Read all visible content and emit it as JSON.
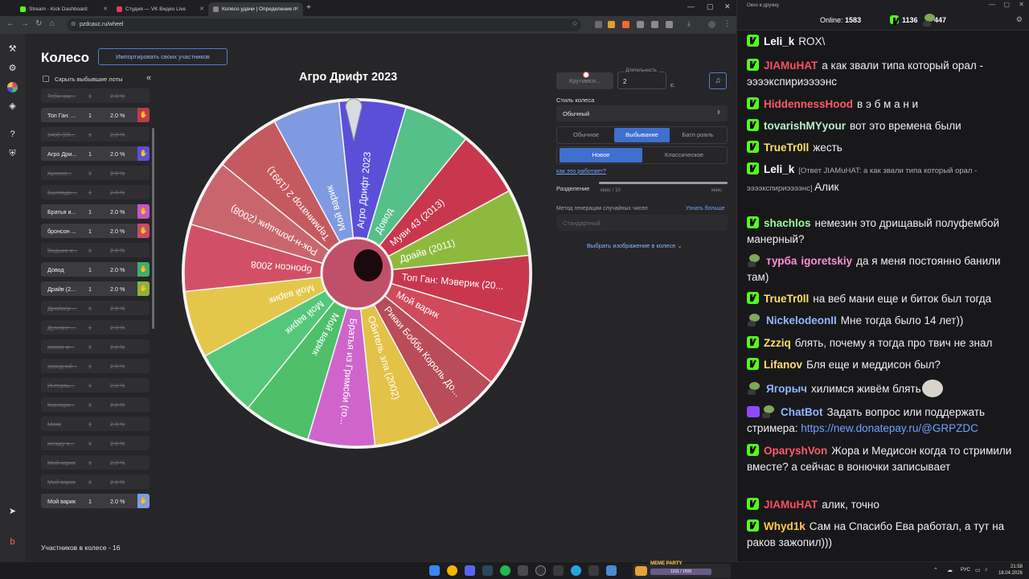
{
  "browser": {
    "tabs": [
      {
        "label": "Stream - Kick Dashboard",
        "color": "#53fc18"
      },
      {
        "label": "Студия — VK Видео Live",
        "color": "#e63b5a"
      },
      {
        "label": "Колесо удачи | Определение п",
        "color": "#888888"
      }
    ],
    "url": "pzdcauc.ru/wheel"
  },
  "page": {
    "title": "Колесо",
    "import_label": "Импортировать своих участников",
    "hide_label": "Скрыть выбывшие лоты",
    "collapse_glyph": "«",
    "participants_count": "Участников в колесе - 16",
    "lots": [
      {
        "name": "Тебя ник...",
        "qty": "1",
        "pct": "2.0 %",
        "state": "crossed"
      },
      {
        "name": "Топ Ган: ...",
        "qty": "1",
        "pct": "2.0 %",
        "state": "active",
        "color": "#c0394b"
      },
      {
        "name": "1408 (20...",
        "qty": "1",
        "pct": "2.0 %",
        "state": "crossed"
      },
      {
        "name": "Агро Дри...",
        "qty": "1",
        "pct": "2.0 %",
        "state": "active",
        "color": "#5b4fd8"
      },
      {
        "name": "Архисо...",
        "qty": "1",
        "pct": "2.0 %",
        "state": "crossed"
      },
      {
        "name": "Баллада ...",
        "qty": "1",
        "pct": "2.0 %",
        "state": "crossed"
      },
      {
        "name": "Братья и...",
        "qty": "1",
        "pct": "2.0 %",
        "state": "active",
        "color": "#c655c6"
      },
      {
        "name": "бронсон ...",
        "qty": "1",
        "pct": "2.0 %",
        "state": "active",
        "color": "#c74c64"
      },
      {
        "name": "Ведьма и...",
        "qty": "1",
        "pct": "2.0 %",
        "state": "crossed"
      },
      {
        "name": "Довод",
        "qty": "1",
        "pct": "2.0 %",
        "state": "active",
        "color": "#3fae6c"
      },
      {
        "name": "Драйв (2...",
        "qty": "1",
        "pct": "2.0 %",
        "state": "active",
        "color": "#8bb33e"
      },
      {
        "name": "Драйвер ...",
        "qty": "1",
        "pct": "2.0 %",
        "state": "crossed"
      },
      {
        "name": "Дуэлянт ...",
        "qty": "1",
        "pct": "2.0 %",
        "state": "crossed"
      },
      {
        "name": "живая м...",
        "qty": "1",
        "pct": "2.0 %",
        "state": "crossed"
      },
      {
        "name": "заводной...",
        "qty": "1",
        "pct": "2.0 %",
        "state": "crossed"
      },
      {
        "name": "Интервь...",
        "qty": "1",
        "pct": "2.0 %",
        "state": "crossed"
      },
      {
        "name": "Кислоро...",
        "qty": "1",
        "pct": "2.0 %",
        "state": "crossed"
      },
      {
        "name": "Маяк",
        "qty": "1",
        "pct": "2.0 %",
        "state": "crossed"
      },
      {
        "name": "между в...",
        "qty": "1",
        "pct": "2.0 %",
        "state": "crossed"
      },
      {
        "name": "Мой варик",
        "qty": "1",
        "pct": "2.0 %",
        "state": "crossed"
      },
      {
        "name": "Мой варик",
        "qty": "1",
        "pct": "2.0 %",
        "state": "crossed"
      },
      {
        "name": "Мой варик",
        "qty": "1",
        "pct": "2.0 %",
        "state": "active",
        "color": "#7f9ae0"
      }
    ],
    "wheel": {
      "title": "Агро Дрифт 2023",
      "segments": [
        {
          "label": "Агро Дрифт 2023",
          "color": "#5b4fd8"
        },
        {
          "label": "Довод",
          "color": "#55c08a"
        },
        {
          "label": "Муви 43 (2013)",
          "color": "#c9374e"
        },
        {
          "label": "Драйв (2011)",
          "color": "#8dba3e"
        },
        {
          "label": "Топ Ган: Мэверик (20...",
          "color": "#c9374e"
        },
        {
          "label": "Мой варик",
          "color": "#d04a5c"
        },
        {
          "label": "Рикки Бобби Король До...",
          "color": "#b84c58"
        },
        {
          "label": "Обитель зла (2002)",
          "color": "#e2c247"
        },
        {
          "label": "Братья из Гримсби (го...",
          "color": "#cf65cb"
        },
        {
          "label": "Мой варик",
          "color": "#4fbf6a"
        },
        {
          "label": "Мой варик",
          "color": "#55c77a"
        },
        {
          "label": "Мой варик",
          "color": "#e4c64a"
        },
        {
          "label": "бронсон 2008",
          "color": "#d25067"
        },
        {
          "label": "Рок-н-рольщик (2008)",
          "color": "#c9666d"
        },
        {
          "label": "Терминатор 2 (1991)",
          "color": "#c45a5f"
        },
        {
          "label": "Мой варик",
          "color": "#7f9ae0"
        }
      ]
    },
    "controls": {
      "spin_label": "Крутимся...",
      "duration_label": "Длительность",
      "duration_value": "2",
      "duration_unit": "с.",
      "style_label": "Стиль колеса",
      "style_value": "Обычный",
      "modes": [
        "Обычное",
        "Выбывание",
        "Батл рояль"
      ],
      "active_mode": "Выбывание",
      "variants": [
        "Новое",
        "Классическое"
      ],
      "active_variant": "Новое",
      "how_link": "как это работает?",
      "split_label": "Разделение",
      "split_min": "макс / 10",
      "split_max": "макс",
      "rng_label": "Метод генерации случайных чисел",
      "learn_more": "Узнать больше",
      "rng_value": "Стандартный",
      "image_picker": "Выбрать изображение в колесе"
    }
  },
  "chat": {
    "window_title": "Окно в дружку",
    "online_label": "Online:",
    "online_count": "1583",
    "stat1": "1136",
    "stat2": "447",
    "messages": [
      {
        "badge": "kick",
        "user": "Leli_k",
        "color": "#ffffff",
        "text": "ROX\\"
      },
      {
        "badge": "kick",
        "user": "JIAMuHAT",
        "color": "#ff4d5e",
        "text": "а как звали типа который орал - ээээкспириээээнс"
      },
      {
        "badge": "kick",
        "user": "HiddennessHood",
        "color": "#ff5a6a",
        "text": "в э б м а н и"
      },
      {
        "badge": "kick",
        "user": "tovarishMYyour",
        "color": "#b8f0c8",
        "text": "вот это времена были"
      },
      {
        "badge": "kick",
        "user": "TrueTr0ll",
        "color": "#ffe066",
        "text": "жесть"
      },
      {
        "badge": "kick",
        "user": "Leli_k",
        "color": "#ffffff",
        "reply": "[Ответ JIAMuHAT: а как звали типа который орал - ээээкспириээээнс]",
        "text": "Алик"
      },
      {
        "badge": "kick",
        "user": "shachlos",
        "color": "#9cff9c",
        "text": "немезин это дрищавый полуфембой манерный?"
      },
      {
        "badge": "frog",
        "user": "турба",
        "color": "#ff8fd8",
        "user2": "igoretskiy",
        "color2": "#ff8fd8",
        "text": "да я меня постоянно банили там)"
      },
      {
        "badge": "kick",
        "user": "TrueTr0ll",
        "color": "#ffe066",
        "text": "на веб мани еще и биток был тогда"
      },
      {
        "badge": "frog",
        "user": "NickelodeonII",
        "color": "#8fb8ff",
        "text": "Мне тогда было 14 лет))"
      },
      {
        "badge": "kick",
        "user": "Zzziq",
        "color": "#ffe066",
        "text": "блять, почему я тогда про твич не знал"
      },
      {
        "badge": "kick",
        "user": "Lifanov",
        "color": "#ffe066",
        "text": "Бля еще и меддисон был?"
      },
      {
        "badge": "frog",
        "user": "Ягорыч",
        "color": "#8fb8ff",
        "text": "хилимся живём блять"
      },
      {
        "badge": "bot",
        "user": "ChatBot",
        "color": "#8fb8ff",
        "text": "Задать вопрос или поддержать стримера:",
        "link": "https://new.donatepay.ru/@GRPZDC"
      },
      {
        "badge": "kick",
        "user": "OparyshVon",
        "color": "#ff5a6a",
        "text": "Жора и Медисон когда то стримили вместе? а сейчас в вонючки записывает"
      },
      {
        "badge": "kick",
        "user": "JIAMuHAT",
        "color": "#ff4d5e",
        "text": "алик, точно"
      },
      {
        "badge": "kick",
        "user": "Whyd1k",
        "color": "#ffc94a",
        "text": "Сам на Спасибо Ева работал, а тут на раков зажопил)))"
      }
    ]
  },
  "taskbar": {
    "widget_label": "MEME PARTY",
    "widget_value": "1331 / 1500",
    "lang": "РУС",
    "time": "21:58",
    "date": "18.04.2026"
  }
}
